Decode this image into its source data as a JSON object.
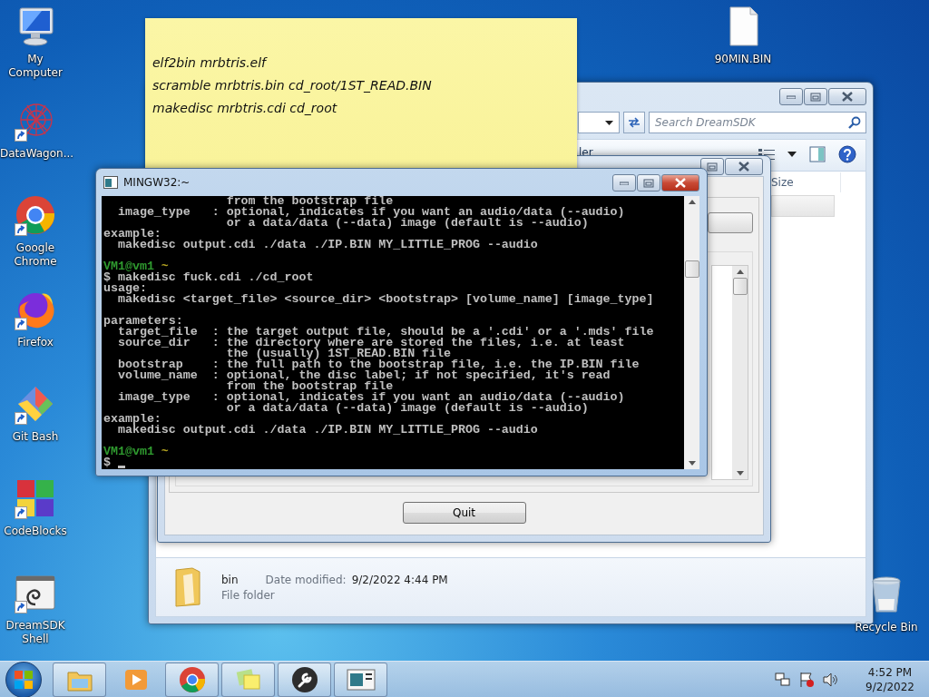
{
  "desktop": {
    "left_icons": [
      {
        "label": "My Computer",
        "kind": "computer",
        "shortcut": false
      },
      {
        "label": "DataWagon...",
        "kind": "datawagon",
        "shortcut": true
      },
      {
        "label": "Google Chrome",
        "kind": "chrome",
        "shortcut": true
      },
      {
        "label": "Firefox",
        "kind": "firefox",
        "shortcut": true
      },
      {
        "label": "Git Bash",
        "kind": "git",
        "shortcut": true
      },
      {
        "label": "CodeBlocks",
        "kind": "codeblocks",
        "shortcut": true
      },
      {
        "label": "DreamSDK Shell",
        "kind": "dreamsdk",
        "shortcut": true
      }
    ],
    "right_icons": [
      {
        "label": "90MIN.BIN",
        "kind": "file",
        "shortcut": false
      },
      {
        "label": "Recycle Bin",
        "kind": "trash",
        "shortcut": false
      }
    ]
  },
  "explorer": {
    "search": {
      "placeholder": "Search DreamSDK"
    },
    "toolbar_text": "ler",
    "column_header": "Size",
    "details": {
      "name": "bin",
      "date_label": "Date modified:",
      "date": "9/2/2022 4:44 PM",
      "type": "File folder"
    }
  },
  "dialog": {
    "button": "Quit"
  },
  "sticky_note": {
    "lines": [
      "elf2bin mrbtris.elf",
      "scramble mrbtris.bin cd_root/1ST_READ.BIN",
      "makedisc mrbtris.cdi cd_root"
    ]
  },
  "terminal": {
    "title": "MINGW32:~",
    "lines": [
      {
        "kind": "text",
        "text": "                 from the bootstrap file"
      },
      {
        "kind": "text",
        "text": "  image_type   : optional, indicates if you want an audio/data (--audio)"
      },
      {
        "kind": "text",
        "text": "                 or a data/data (--data) image (default is --audio)"
      },
      {
        "kind": "text",
        "text": "example:"
      },
      {
        "kind": "text",
        "text": "  makedisc output.cdi ./data ./IP.BIN MY_LITTLE_PROG --audio"
      },
      {
        "kind": "blank"
      },
      {
        "kind": "prompt",
        "user": "VM1@vm1",
        "path": "~"
      },
      {
        "kind": "text",
        "text": "$ makedisc fuck.cdi ./cd_root"
      },
      {
        "kind": "text",
        "text": "usage:"
      },
      {
        "kind": "text",
        "text": "  makedisc <target_file> <source_dir> <bootstrap> [volume_name] [image_type]"
      },
      {
        "kind": "blank"
      },
      {
        "kind": "text",
        "text": "parameters:"
      },
      {
        "kind": "text",
        "text": "  target_file  : the target output file, should be a '.cdi' or a '.mds' file"
      },
      {
        "kind": "text",
        "text": "  source_dir   : the directory where are stored the files, i.e. at least"
      },
      {
        "kind": "text",
        "text": "                 the (usually) 1ST_READ.BIN file"
      },
      {
        "kind": "text",
        "text": "  bootstrap    : the full path to the bootstrap file, i.e. the IP.BIN file"
      },
      {
        "kind": "text",
        "text": "  volume_name  : optional, the disc label; if not specified, it's read"
      },
      {
        "kind": "text",
        "text": "                 from the bootstrap file"
      },
      {
        "kind": "text",
        "text": "  image_type   : optional, indicates if you want an audio/data (--audio)"
      },
      {
        "kind": "text",
        "text": "                 or a data/data (--data) image (default is --audio)"
      },
      {
        "kind": "text",
        "text": "example:"
      },
      {
        "kind": "text",
        "text": "  makedisc output.cdi ./data ./IP.BIN MY_LITTLE_PROG --audio"
      },
      {
        "kind": "blank"
      },
      {
        "kind": "prompt",
        "user": "VM1@vm1",
        "path": "~"
      },
      {
        "kind": "input",
        "text": "$",
        "cursor": true
      }
    ]
  },
  "taskbar": {
    "items": [
      {
        "kind": "explorer",
        "running": true
      },
      {
        "kind": "media",
        "running": false
      },
      {
        "kind": "chrome",
        "running": true
      },
      {
        "kind": "sticky",
        "running": true
      },
      {
        "kind": "wrench",
        "running": true
      },
      {
        "kind": "window",
        "running": true
      }
    ],
    "clock": {
      "time": "4:52 PM",
      "date": "9/2/2022"
    }
  }
}
